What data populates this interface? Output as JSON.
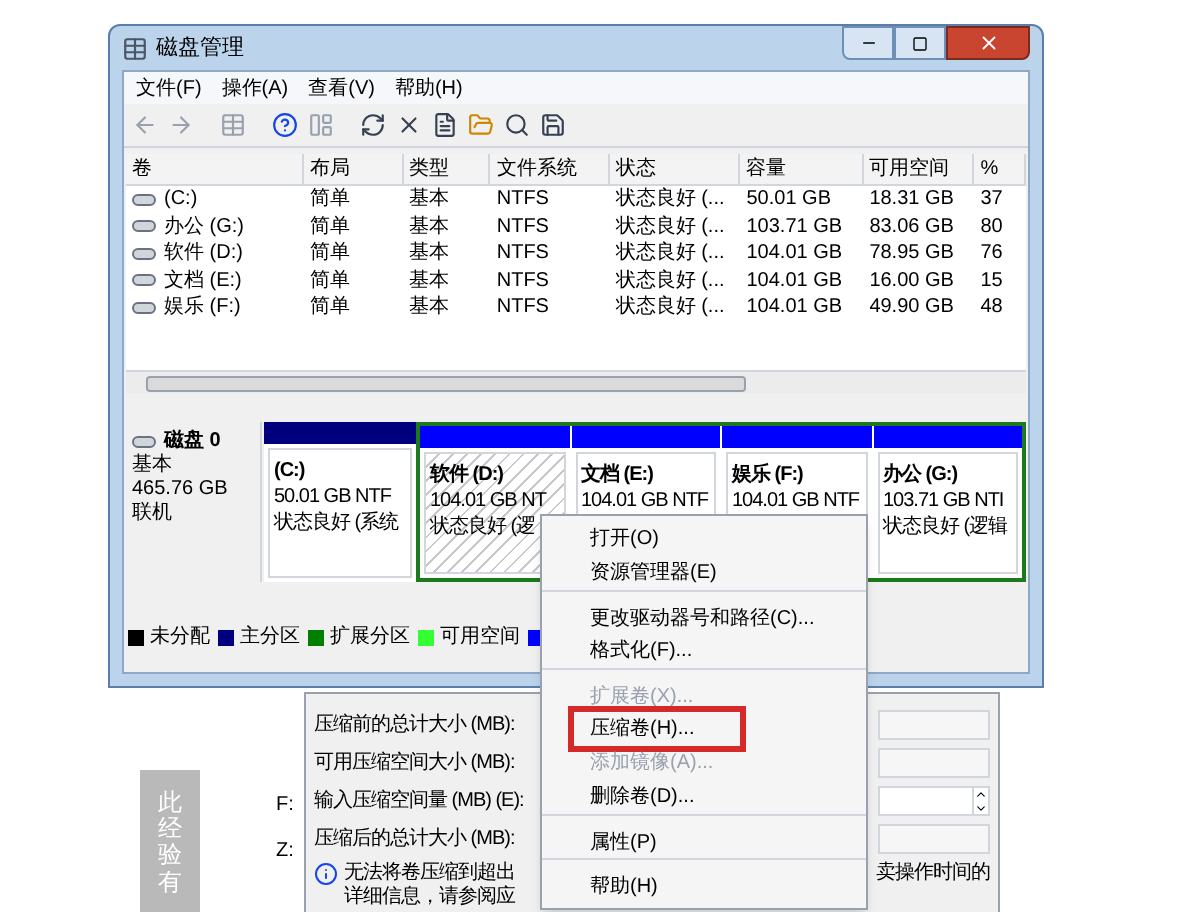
{
  "window": {
    "title": "磁盘管理",
    "menus": [
      "文件(F)",
      "操作(A)",
      "查看(V)",
      "帮助(H)"
    ]
  },
  "table": {
    "columns": [
      "卷",
      "布局",
      "类型",
      "文件系统",
      "状态",
      "容量",
      "可用空间",
      "%"
    ],
    "rows": [
      [
        "(C:)",
        "简单",
        "基本",
        "NTFS",
        "状态良好 (...",
        "50.01 GB",
        "18.31 GB",
        "37"
      ],
      [
        "办公 (G:)",
        "简单",
        "基本",
        "NTFS",
        "状态良好 (...",
        "103.71 GB",
        "83.06 GB",
        "80"
      ],
      [
        "软件 (D:)",
        "简单",
        "基本",
        "NTFS",
        "状态良好 (...",
        "104.01 GB",
        "78.95 GB",
        "76"
      ],
      [
        "文档 (E:)",
        "简单",
        "基本",
        "NTFS",
        "状态良好 (...",
        "104.01 GB",
        "16.00 GB",
        "15"
      ],
      [
        "娱乐 (F:)",
        "简单",
        "基本",
        "NTFS",
        "状态良好 (...",
        "104.01 GB",
        "49.90 GB",
        "48"
      ]
    ]
  },
  "disk": {
    "name": "磁盘 0",
    "type": "基本",
    "size": "465.76 GB",
    "status": "联机",
    "partitions": [
      {
        "label": "(C:)",
        "size": "50.01 GB NTF",
        "status": "状态良好 (系统",
        "kind": "primary",
        "selected": false
      },
      {
        "label": "软件 (D:)",
        "size": "104.01 GB NT",
        "status": "状态良好 (逻",
        "kind": "logical",
        "selected": true
      },
      {
        "label": "文档 (E:)",
        "size": "104.01 GB NTF",
        "kind": "logical",
        "selected": false
      },
      {
        "label": "娱乐 (F:)",
        "size": "104.01 GB NTF",
        "kind": "logical",
        "selected": false
      },
      {
        "label": "办公 (G:)",
        "size": "103.71 GB NTI",
        "status": "状态良好 (逻辑",
        "kind": "logical",
        "selected": false
      }
    ]
  },
  "legend": [
    {
      "label": "未分配",
      "color": "#000000"
    },
    {
      "label": "主分区",
      "color": "#00007f"
    },
    {
      "label": "扩展分区",
      "color": "#008000"
    },
    {
      "label": "可用空间",
      "color": "#33ff33"
    },
    {
      "color": "#0000ff"
    }
  ],
  "context_menu": [
    {
      "label": "打开(O)",
      "disabled": false,
      "highlighted": false,
      "separator_before": false
    },
    {
      "label": "资源管理器(E)",
      "disabled": false,
      "highlighted": false,
      "separator_before": false
    },
    {
      "label": "更改驱动器号和路径(C)...",
      "disabled": false,
      "highlighted": false,
      "separator_before": true
    },
    {
      "label": "格式化(F)...",
      "disabled": false,
      "highlighted": false,
      "separator_before": false
    },
    {
      "label": "扩展卷(X)...",
      "disabled": true,
      "highlighted": false,
      "separator_before": true
    },
    {
      "label": "压缩卷(H)...",
      "disabled": false,
      "highlighted": true,
      "separator_before": false
    },
    {
      "label": "添加镜像(A)...",
      "disabled": true,
      "highlighted": false,
      "separator_before": false
    },
    {
      "label": "删除卷(D)...",
      "disabled": false,
      "highlighted": false,
      "separator_before": false
    },
    {
      "label": "属性(P)",
      "disabled": false,
      "highlighted": false,
      "separator_before": true
    },
    {
      "label": "帮助(H)",
      "disabled": false,
      "highlighted": false,
      "separator_before": true
    }
  ],
  "shrink_dialog": {
    "fields": [
      {
        "label": "压缩前的总计大小 (MB):",
        "kind": "text"
      },
      {
        "label": "可用压缩空间大小 (MB):",
        "kind": "text"
      },
      {
        "label": "输入压缩空间量 (MB) (E):",
        "kind": "spin"
      },
      {
        "label": "压缩后的总计大小 (MB):",
        "kind": "text"
      }
    ],
    "info": [
      "无法将卷压缩到超出",
      "详细信息，请参阅应"
    ],
    "info_right": "卖操作时间的"
  },
  "side_fragments": [
    "F:",
    "Z:"
  ],
  "side_tab": "此经验有"
}
